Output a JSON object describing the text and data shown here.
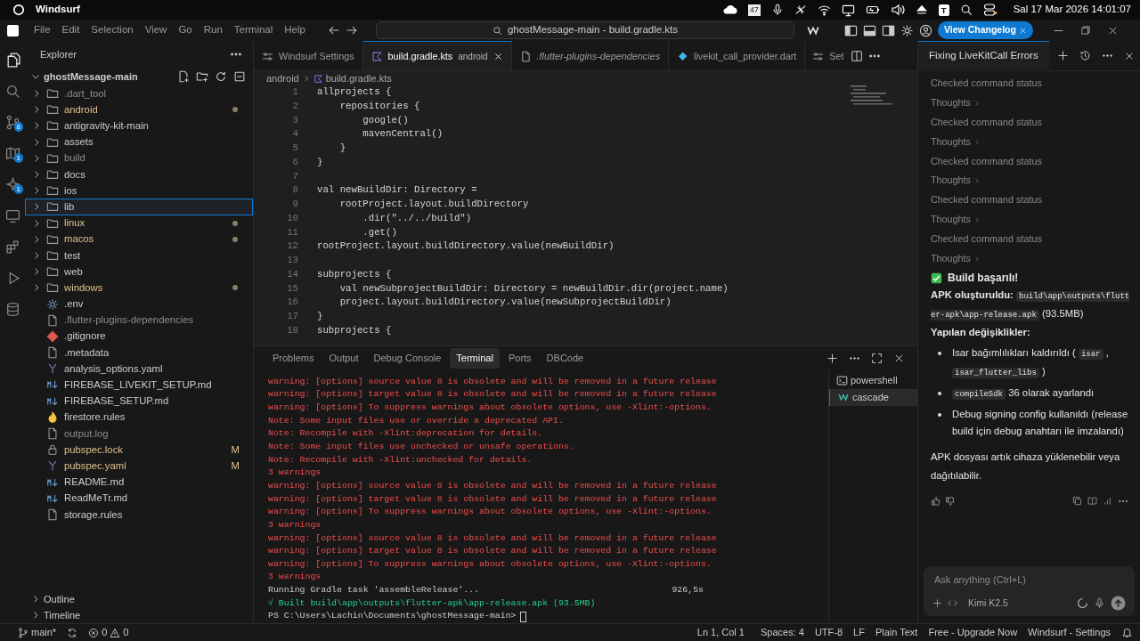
{
  "os_bar": {
    "app": "Windsurf",
    "calendar_badge": "47",
    "tray_letter": "T",
    "clock": "Sal 17 Mar 2026 14:01:07"
  },
  "menu": [
    "File",
    "Edit",
    "Selection",
    "View",
    "Go",
    "Run",
    "Terminal",
    "Help"
  ],
  "command_center": "ghostMessage-main - build.gradle.kts",
  "changelog_button": "View Changelog",
  "activity_bar": [
    {
      "kind": "files",
      "selected": true
    },
    {
      "kind": "search",
      "selected": false
    },
    {
      "kind": "source-control",
      "badge": "8",
      "selected": false
    },
    {
      "kind": "map",
      "badge": "1",
      "selected": false
    },
    {
      "kind": "sparkle",
      "badge": "1",
      "selected": false
    },
    {
      "kind": "remote",
      "selected": false
    },
    {
      "kind": "extensions",
      "selected": false
    },
    {
      "kind": "run",
      "selected": false
    },
    {
      "kind": "database",
      "selected": false
    }
  ],
  "explorer": {
    "title": "Explorer",
    "root": "ghostMessage-main",
    "items": [
      {
        "name": ".dart_tool",
        "kind": "folder",
        "modified": false,
        "ignored": true,
        "selected": false
      },
      {
        "name": "android",
        "kind": "folder",
        "modified": true,
        "ignored": false,
        "dot": true,
        "selected": false
      },
      {
        "name": "antigravity-kit-main",
        "kind": "folder",
        "modified": false,
        "ignored": false,
        "selected": false
      },
      {
        "name": "assets",
        "kind": "folder",
        "modified": false,
        "ignored": false,
        "selected": false
      },
      {
        "name": "build",
        "kind": "folder",
        "modified": false,
        "ignored": true,
        "selected": false
      },
      {
        "name": "docs",
        "kind": "folder",
        "modified": false,
        "ignored": false,
        "selected": false
      },
      {
        "name": "ios",
        "kind": "folder",
        "modified": false,
        "ignored": false,
        "selected": false
      },
      {
        "name": "lib",
        "kind": "folder",
        "modified": false,
        "ignored": false,
        "selected": true
      },
      {
        "name": "linux",
        "kind": "folder",
        "modified": true,
        "ignored": false,
        "dot": true,
        "selected": false
      },
      {
        "name": "macos",
        "kind": "folder",
        "modified": true,
        "ignored": false,
        "dot": true,
        "selected": false
      },
      {
        "name": "test",
        "kind": "folder",
        "modified": false,
        "ignored": false,
        "selected": false
      },
      {
        "name": "web",
        "kind": "folder",
        "modified": false,
        "ignored": false,
        "selected": false
      },
      {
        "name": "windows",
        "kind": "folder",
        "modified": true,
        "ignored": false,
        "dot": true,
        "selected": false
      },
      {
        "name": ".env",
        "kind": "gear",
        "modified": false,
        "ignored": false,
        "selected": false
      },
      {
        "name": ".flutter-plugins-dependencies",
        "kind": "file",
        "modified": false,
        "ignored": true,
        "selected": false
      },
      {
        "name": ".gitignore",
        "kind": "git",
        "modified": false,
        "ignored": false,
        "selected": false
      },
      {
        "name": ".metadata",
        "kind": "file",
        "modified": false,
        "ignored": false,
        "selected": false
      },
      {
        "name": "analysis_options.yaml",
        "kind": "yaml",
        "modified": false,
        "ignored": false,
        "selected": false
      },
      {
        "name": "FIREBASE_LIVEKIT_SETUP.md",
        "kind": "markdown",
        "modified": false,
        "ignored": false,
        "selected": false
      },
      {
        "name": "FIREBASE_SETUP.md",
        "kind": "markdown",
        "modified": false,
        "ignored": false,
        "selected": false
      },
      {
        "name": "firestore.rules",
        "kind": "fire",
        "modified": false,
        "ignored": false,
        "selected": false
      },
      {
        "name": "output.log",
        "kind": "file",
        "modified": false,
        "ignored": true,
        "selected": false
      },
      {
        "name": "pubspec.lock",
        "kind": "lock",
        "modified": true,
        "ignored": false,
        "badge": "M",
        "selected": false
      },
      {
        "name": "pubspec.yaml",
        "kind": "yaml",
        "modified": true,
        "ignored": false,
        "badge": "M",
        "selected": false
      },
      {
        "name": "README.md",
        "kind": "markdown",
        "modified": false,
        "ignored": false,
        "selected": false
      },
      {
        "name": "ReadMeTr.md",
        "kind": "markdown",
        "modified": false,
        "ignored": false,
        "selected": false
      },
      {
        "name": "storage.rules",
        "kind": "file",
        "modified": false,
        "ignored": false,
        "selected": false
      }
    ],
    "sections": [
      "Outline",
      "Timeline"
    ]
  },
  "editor_tabs": [
    {
      "label": "Windsurf Settings",
      "kind": "settings",
      "selected": false
    },
    {
      "label": "build.gradle.kts",
      "detail": "android",
      "kind": "kotlin",
      "selected": true
    },
    {
      "label": ".flutter-plugins-dependencies",
      "kind": "file",
      "italic": true,
      "selected": false
    },
    {
      "label": "livekit_call_provider.dart",
      "kind": "dart",
      "selected": false
    },
    {
      "label": "Set",
      "kind": "settings",
      "selected": false
    }
  ],
  "breadcrumb": [
    "android",
    "build.gradle.kts"
  ],
  "code": [
    {
      "number": "1",
      "text": "allprojects {"
    },
    {
      "number": "2",
      "text": "    repositories {"
    },
    {
      "number": "3",
      "text": "        google()"
    },
    {
      "number": "4",
      "text": "        mavenCentral()"
    },
    {
      "number": "5",
      "text": "    }"
    },
    {
      "number": "6",
      "text": "}"
    },
    {
      "number": "7"
    },
    {
      "number": "8",
      "text": "val newBuildDir: Directory ="
    },
    {
      "number": "9",
      "text": "    rootProject.layout.buildDirectory"
    },
    {
      "number": "10",
      "text": "        .dir(\"../../build\")"
    },
    {
      "number": "11",
      "text": "        .get()"
    },
    {
      "number": "12",
      "text": "rootProject.layout.buildDirectory.value(newBuildDir)"
    },
    {
      "number": "13"
    },
    {
      "number": "14",
      "text": "subprojects {"
    },
    {
      "number": "15",
      "text": "    val newSubprojectBuildDir: Directory = newBuildDir.dir(project.name)"
    },
    {
      "number": "16",
      "text": "    project.layout.buildDirectory.value(newSubprojectBuildDir)"
    },
    {
      "number": "17",
      "text": "}"
    },
    {
      "number": "18",
      "text": "subprojects {"
    }
  ],
  "panel": {
    "tabs": [
      {
        "label": "Problems",
        "selected": false
      },
      {
        "label": "Output",
        "selected": false
      },
      {
        "label": "Debug Console",
        "selected": false
      },
      {
        "label": "Terminal",
        "selected": true
      },
      {
        "label": "Ports",
        "selected": false
      },
      {
        "label": "DBCode",
        "selected": false
      }
    ],
    "lines": [
      {
        "kind": "error",
        "text": "warning: [options] source value 8 is obsolete and will be removed in a future release"
      },
      {
        "kind": "error",
        "text": "warning: [options] target value 8 is obsolete and will be removed in a future release"
      },
      {
        "kind": "error",
        "text": "warning: [options] To suppress warnings about obsolete options, use -Xlint:-options."
      },
      {
        "kind": "error",
        "text": "Note: Some input files use or override a deprecated API."
      },
      {
        "kind": "error",
        "text": "Note: Recompile with -Xlint:deprecation for details."
      },
      {
        "kind": "error",
        "text": "Note: Some input files use unchecked or unsafe operations."
      },
      {
        "kind": "error",
        "text": "Note: Recompile with -Xlint:unchecked for details."
      },
      {
        "kind": "error",
        "text": "3 warnings"
      },
      {
        "kind": "error",
        "text": "warning: [options] source value 8 is obsolete and will be removed in a future release"
      },
      {
        "kind": "error",
        "text": "warning: [options] target value 8 is obsolete and will be removed in a future release"
      },
      {
        "kind": "error",
        "text": "warning: [options] To suppress warnings about obsolete options, use -Xlint:-options."
      },
      {
        "kind": "error",
        "text": "3 warnings"
      },
      {
        "kind": "error",
        "text": "warning: [options] source value 8 is obsolete and will be removed in a future release"
      },
      {
        "kind": "error",
        "text": "warning: [options] target value 8 is obsolete and will be removed in a future release"
      },
      {
        "kind": "error",
        "text": "warning: [options] To suppress warnings about obsolete options, use -Xlint:-options."
      },
      {
        "kind": "error",
        "text": "3 warnings"
      },
      {
        "kind": "task",
        "text": "Running Gradle task 'assembleRelease'...",
        "time": "926,5s"
      },
      {
        "kind": "success",
        "text": "√ Built build\\app\\outputs\\flutter-apk\\app-release.apk (93.5MB)"
      },
      {
        "kind": "prompt",
        "text": "PS C:\\Users\\Lachin\\Documents\\ghostMessage-main>"
      }
    ],
    "terminals": [
      {
        "label": "powershell",
        "kind": "shell",
        "selected": false
      },
      {
        "label": "cascade",
        "kind": "cascade",
        "selected": true
      }
    ]
  },
  "chat": {
    "title": "Fixing LiveKitCall Errors",
    "steps": [
      {
        "label": "Checked command status",
        "toggle": "Thoughts"
      },
      {
        "label": "Checked command status",
        "toggle": "Thoughts"
      },
      {
        "label": "Checked command status",
        "toggle": "Thoughts"
      },
      {
        "label": "Checked command status",
        "toggle": "Thoughts"
      },
      {
        "label": "Checked command status",
        "toggle": "Thoughts"
      }
    ],
    "heading": "Build başarılı!",
    "apk_line": [
      {
        "kind": "bold",
        "text": "APK oluşturuldu:"
      },
      {
        "kind": "code",
        "text": "build\\app\\outputs\\flutter-apk\\app-release.apk"
      },
      {
        "kind": "plain",
        "text": "(93.5MB)"
      }
    ],
    "changes_heading": "Yapılan değişiklikler:",
    "bullets": [
      [
        {
          "kind": "plain",
          "text": "Isar bağımlılıkları kaldırıldı ("
        },
        {
          "kind": "code",
          "text": "isar"
        },
        {
          "kind": "plain",
          "text": ","
        },
        {
          "kind": "code",
          "text": "isar_flutter_libs"
        },
        {
          "kind": "plain",
          "text": ")"
        }
      ],
      [
        {
          "kind": "code",
          "text": "compileSdk"
        },
        {
          "kind": "plain",
          "text": "36 olarak ayarlandı"
        }
      ],
      [
        {
          "kind": "plain",
          "text": "Debug signing config kullanıldı (release build için debug anahtarı ile imzalandı)"
        }
      ]
    ],
    "closing": "APK dosyası artık cihaza yüklenebilir veya dağıtılabilir.",
    "input_placeholder": "Ask anything (Ctrl+L)",
    "model": "Kimi K2.5"
  },
  "status_bar": {
    "branch": "main*",
    "errors": "0",
    "warnings": "0",
    "items": [
      "Ln 1, Col 1",
      "Spaces: 4",
      "UTF-8",
      "LF",
      "Plain Text",
      "Free - Upgrade Now",
      "Windsurf - Settings"
    ]
  }
}
